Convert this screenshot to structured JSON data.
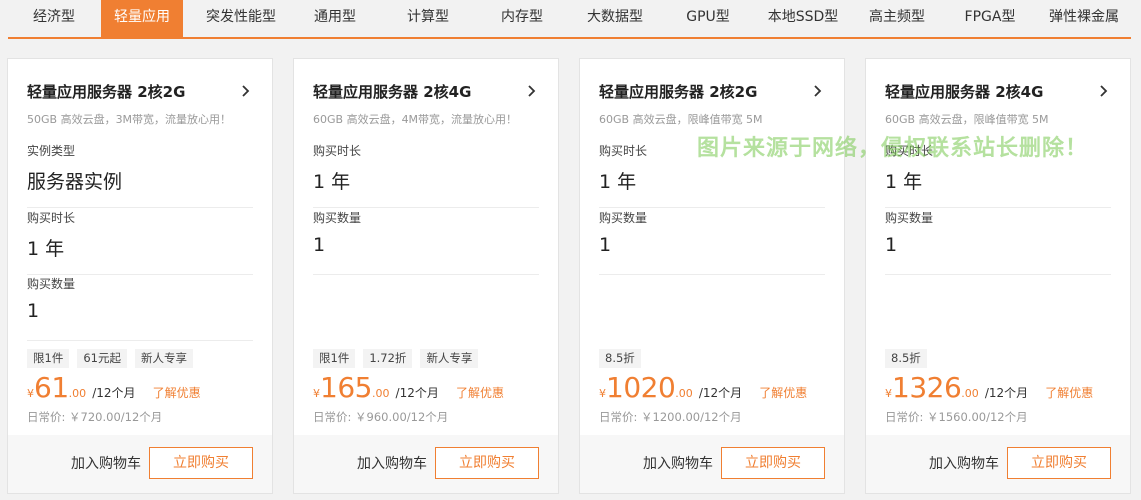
{
  "tabs": [
    {
      "label": "经济型",
      "active": false
    },
    {
      "label": "轻量应用",
      "active": true
    },
    {
      "label": "突发性能型",
      "active": false
    },
    {
      "label": "通用型",
      "active": false
    },
    {
      "label": "计算型",
      "active": false
    },
    {
      "label": "内存型",
      "active": false
    },
    {
      "label": "大数据型",
      "active": false
    },
    {
      "label": "GPU型",
      "active": false
    },
    {
      "label": "本地SSD型",
      "active": false
    },
    {
      "label": "高主频型",
      "active": false
    },
    {
      "label": "FPGA型",
      "active": false
    },
    {
      "label": "弹性裸金属",
      "active": false
    }
  ],
  "cards": [
    {
      "title": "轻量应用服务器 2核2G",
      "subtitle": "50GB 高效云盘，3M带宽，流量放心用！",
      "fields": [
        {
          "label": "实例类型",
          "value": "服务器实例"
        },
        {
          "label": "购买时长",
          "value": "1 年"
        },
        {
          "label": "购买数量",
          "value": "1"
        }
      ],
      "tags": [
        "限1件",
        "61元起",
        "新人专享"
      ],
      "price": {
        "yen": "¥",
        "int": "61",
        "dec": ".00",
        "period": "/12个月"
      },
      "promo": "了解优惠",
      "daily_price": "日常价: ￥720.00/12个月",
      "cart_label": "加入购物车",
      "buy_label": "立即购买"
    },
    {
      "title": "轻量应用服务器 2核4G",
      "subtitle": "60GB 高效云盘，4M带宽，流量放心用！",
      "fields": [
        {
          "label": "购买时长",
          "value": "1 年"
        },
        {
          "label": "购买数量",
          "value": "1"
        }
      ],
      "tags": [
        "限1件",
        "1.72折",
        "新人专享"
      ],
      "price": {
        "yen": "¥",
        "int": "165",
        "dec": ".00",
        "period": "/12个月"
      },
      "promo": "了解优惠",
      "daily_price": "日常价: ￥960.00/12个月",
      "cart_label": "加入购物车",
      "buy_label": "立即购买"
    },
    {
      "title": "轻量应用服务器 2核2G",
      "subtitle": "60GB 高效云盘，限峰值带宽 5M",
      "fields": [
        {
          "label": "购买时长",
          "value": "1 年"
        },
        {
          "label": "购买数量",
          "value": "1"
        }
      ],
      "tags": [
        "8.5折"
      ],
      "price": {
        "yen": "¥",
        "int": "1020",
        "dec": ".00",
        "period": "/12个月"
      },
      "promo": "了解优惠",
      "daily_price": "日常价: ￥1200.00/12个月",
      "cart_label": "加入购物车",
      "buy_label": "立即购买"
    },
    {
      "title": "轻量应用服务器 2核4G",
      "subtitle": "60GB 高效云盘，限峰值带宽 5M",
      "fields": [
        {
          "label": "购买时长",
          "value": "1 年"
        },
        {
          "label": "购买数量",
          "value": "1"
        }
      ],
      "tags": [
        "8.5折"
      ],
      "price": {
        "yen": "¥",
        "int": "1326",
        "dec": ".00",
        "period": "/12个月"
      },
      "promo": "了解优惠",
      "daily_price": "日常价: ￥1560.00/12个月",
      "cart_label": "加入购物车",
      "buy_label": "立即购买"
    }
  ],
  "watermark": "图片来源于网络，侵权联系站长删除！",
  "colors": {
    "accent": "#f07f32",
    "background": "#f2f2f2"
  },
  "icons": {
    "card_arrow": "chevron-right-icon"
  }
}
